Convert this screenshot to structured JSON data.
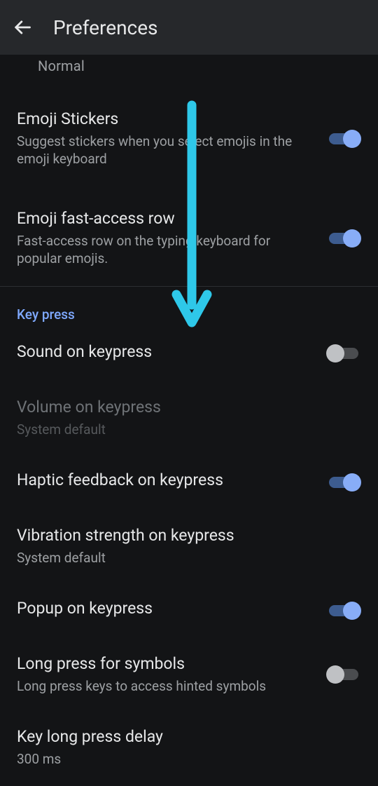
{
  "header": {
    "title": "Preferences"
  },
  "truncated": {
    "line": "Normal"
  },
  "items": {
    "emoji_stickers": {
      "title": "Emoji Stickers",
      "sub": "Suggest stickers when you select emojis in the emoji keyboard",
      "on": true
    },
    "emoji_fast_row": {
      "title": "Emoji fast-access row",
      "sub": "Fast-access row on the typing keyboard for popular emojis.",
      "on": true
    },
    "section_keypress": "Key press",
    "sound_on_keypress": {
      "title": "Sound on keypress",
      "on": false
    },
    "volume_on_keypress": {
      "title": "Volume on keypress",
      "sub": "System default"
    },
    "haptic_feedback": {
      "title": "Haptic feedback on keypress",
      "on": true
    },
    "vibration_strength": {
      "title": "Vibration strength on keypress",
      "sub": "System default"
    },
    "popup_on_keypress": {
      "title": "Popup on keypress",
      "on": true
    },
    "long_press_symbols": {
      "title": "Long press for symbols",
      "sub": "Long press keys to access hinted symbols",
      "on": false
    },
    "long_press_delay": {
      "title": "Key long press delay",
      "sub": "300 ms"
    }
  },
  "annotation": {
    "arrow_color": "#2ec8e9"
  }
}
